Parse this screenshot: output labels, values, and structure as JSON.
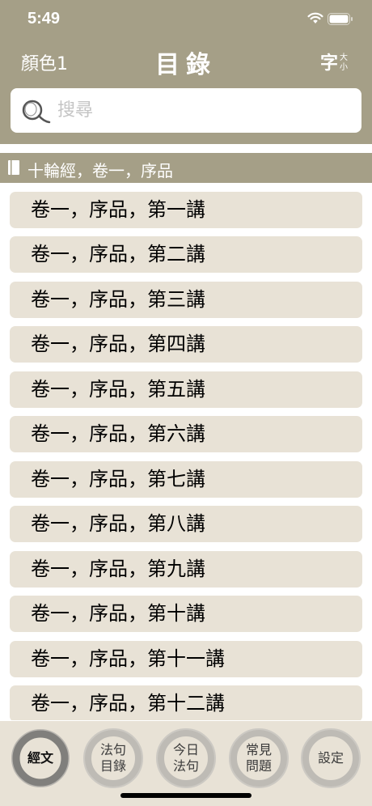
{
  "status": {
    "time": "5:49"
  },
  "nav": {
    "color_label": "顏色1",
    "title": "目錄",
    "font_big": "字",
    "font_small_1": "大",
    "font_small_2": "小"
  },
  "search": {
    "placeholder": "搜尋"
  },
  "section": {
    "title": "十輪經，卷一，序品"
  },
  "items": [
    "卷一，序品，第一講",
    "卷一，序品，第二講",
    "卷一，序品，第三講",
    "卷一，序品，第四講",
    "卷一，序品，第五講",
    "卷一，序品，第六講",
    "卷一，序品，第七講",
    "卷一，序品，第八講",
    "卷一，序品，第九講",
    "卷一，序品，第十講",
    "卷一，序品，第十一講",
    "卷一，序品，第十二講"
  ],
  "tabs": [
    {
      "label": "經文",
      "active": true
    },
    {
      "label": "法句\n目錄",
      "active": false
    },
    {
      "label": "今日\n法句",
      "active": false
    },
    {
      "label": "常見\n問題",
      "active": false
    },
    {
      "label": "設定",
      "active": false
    }
  ],
  "colors": {
    "accent": "#a59f87",
    "row_bg": "#e8e2d6"
  }
}
